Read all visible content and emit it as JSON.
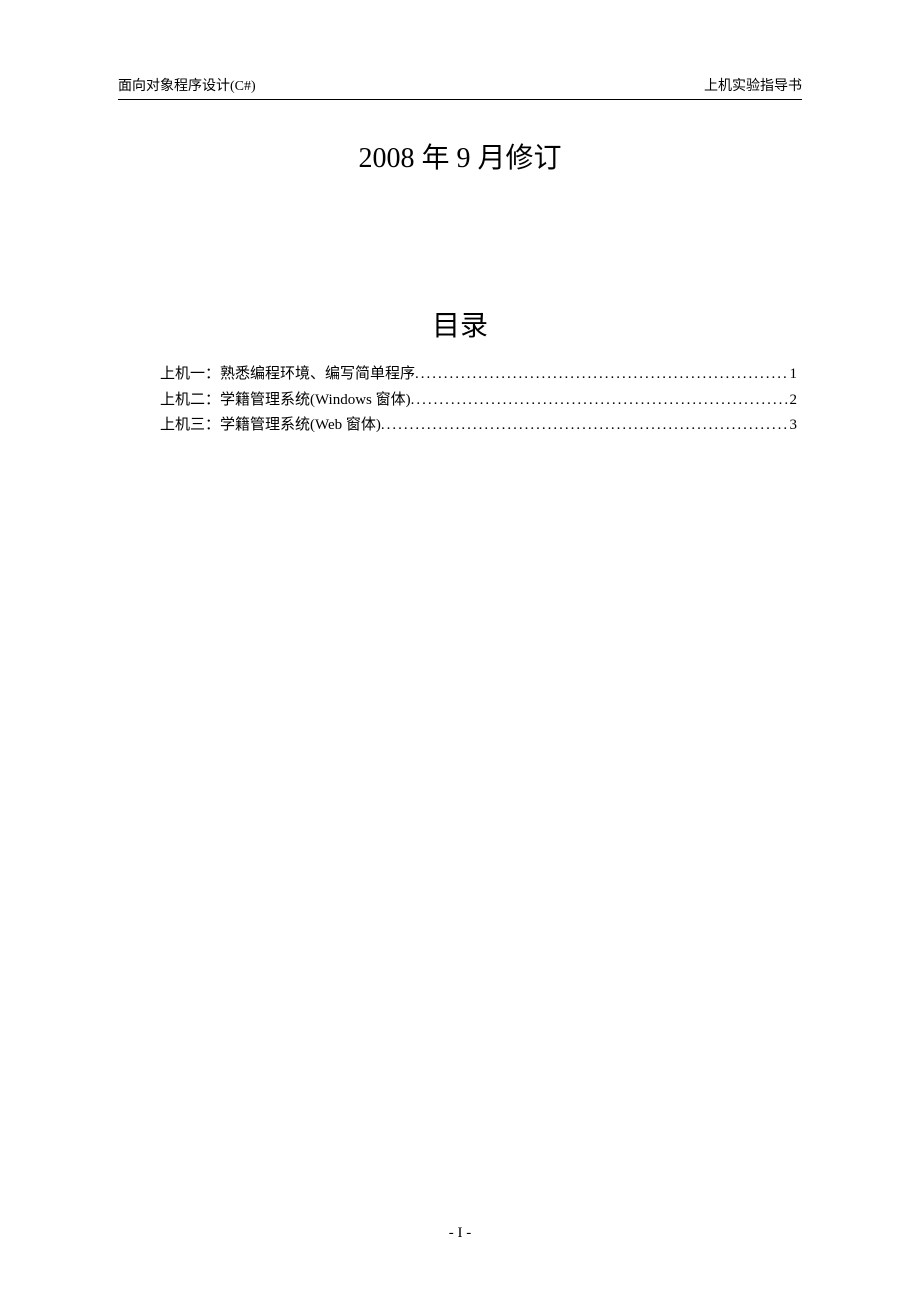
{
  "header": {
    "left": "面向对象程序设计(C#)",
    "right": "上机实验指导书"
  },
  "revision": "2008 年 9 月修订",
  "toc": {
    "title": "目录",
    "entries": [
      {
        "label": "上机一：熟悉编程环境、编写简单程序",
        "page": "1"
      },
      {
        "label": "上机二：学籍管理系统(Windows 窗体)",
        "page": "2"
      },
      {
        "label": "上机三：学籍管理系统(Web 窗体) ",
        "page": "3"
      }
    ]
  },
  "leader": "...............................................................................................................................",
  "footer": "- I -"
}
